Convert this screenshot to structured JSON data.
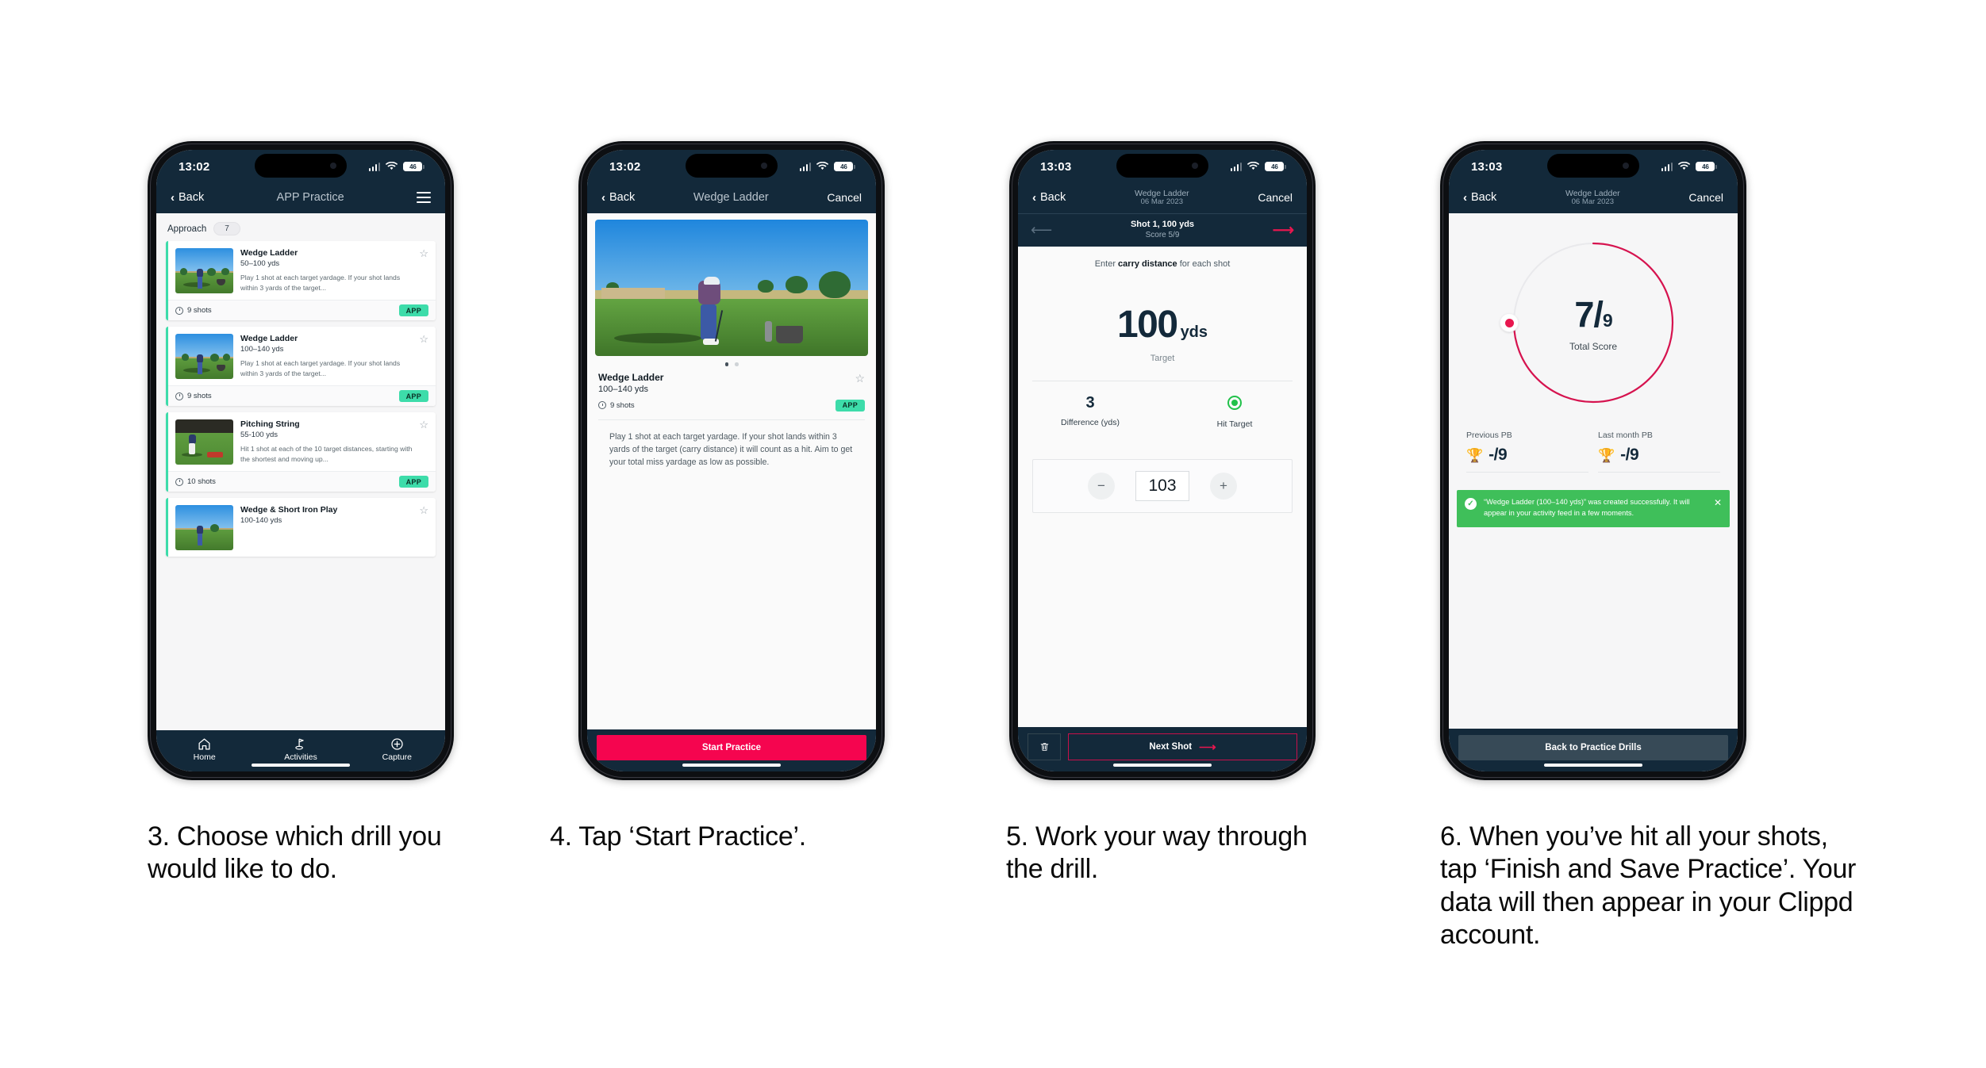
{
  "captions": [
    "3. Choose which drill you would like to do.",
    "4. Tap ‘Start Practice’.",
    "5. Work your way through the drill.",
    "6. When you’ve hit all your shots, tap ‘Finish and Save Practice’. Your data will then appear in your Clippd account."
  ],
  "colors": {
    "navy": "#13293a",
    "pink": "#f5054f",
    "mint": "#3ddcaa",
    "green": "#3fbf5a",
    "crimson": "#e8174f"
  },
  "phone1": {
    "status": {
      "time": "13:02",
      "battery": "46"
    },
    "nav": {
      "back": "Back",
      "title": "APP Practice",
      "menu_icon": "hamburger-icon"
    },
    "filter": {
      "label": "Approach",
      "count": "7"
    },
    "cards": [
      {
        "title": "Wedge Ladder",
        "yardage": "50–100 yds",
        "desc": "Play 1 shot at each target yardage. If your shot lands within 3 yards of the target...",
        "shots": "9 shots",
        "badge": "APP"
      },
      {
        "title": "Wedge Ladder",
        "yardage": "100–140 yds",
        "desc": "Play 1 shot at each target yardage. If your shot lands within 3 yards of the target...",
        "shots": "9 shots",
        "badge": "APP"
      },
      {
        "title": "Pitching String",
        "yardage": "55-100 yds",
        "desc": "Hit 1 shot at each of the 10 target distances, starting with the shortest and moving up...",
        "shots": "10 shots",
        "badge": "APP"
      },
      {
        "title": "Wedge & Short Iron Play",
        "yardage": "100-140 yds",
        "desc": "",
        "shots": "",
        "badge": ""
      }
    ],
    "tabs": [
      {
        "label": "Home",
        "icon": "home-icon"
      },
      {
        "label": "Activities",
        "icon": "golf-flag-icon"
      },
      {
        "label": "Capture",
        "icon": "plus-circle-icon"
      }
    ]
  },
  "phone2": {
    "status": {
      "time": "13:02",
      "battery": "46"
    },
    "nav": {
      "back": "Back",
      "title": "Wedge Ladder",
      "cancel": "Cancel"
    },
    "drill": {
      "title": "Wedge Ladder",
      "yardage": "100–140 yds",
      "shots": "9 shots",
      "badge": "APP",
      "description": "Play 1 shot at each target yardage. If your shot lands within 3 yards of the target (carry distance) it will count as a hit. Aim to get your total miss yardage as low as possible."
    },
    "cta": "Start Practice"
  },
  "phone3": {
    "status": {
      "time": "13:03",
      "battery": "46"
    },
    "nav": {
      "back": "Back",
      "title": "Wedge Ladder",
      "date": "06 Mar 2023",
      "cancel": "Cancel"
    },
    "shotbar": {
      "shot": "Shot 1, 100 yds",
      "score": "Score 5/9"
    },
    "hint_pre": "Enter ",
    "hint_bold": "carry distance",
    "hint_post": " for each shot",
    "target": {
      "value": "100",
      "unit": "yds",
      "caption": "Target"
    },
    "stats": [
      {
        "value": "3",
        "label": "Difference (yds)"
      },
      {
        "value": "",
        "label": "Hit Target",
        "icon": "target-hit-icon"
      }
    ],
    "stepper": {
      "minus": "−",
      "value": "103",
      "plus": "+"
    },
    "footer": {
      "delete_icon": "trash-icon",
      "next": "Next Shot"
    }
  },
  "phone4": {
    "status": {
      "time": "13:03",
      "battery": "46"
    },
    "nav": {
      "back": "Back",
      "title": "Wedge Ladder",
      "date": "06 Mar 2023",
      "cancel": "Cancel"
    },
    "gauge": {
      "score": "7",
      "separator": "/",
      "total": "9",
      "label": "Total Score",
      "percent": 78
    },
    "pbs": [
      {
        "label": "Previous PB",
        "value": "-/9",
        "icon": "trophy-icon"
      },
      {
        "label": "Last month PB",
        "value": "-/9",
        "icon": "trophy-icon"
      }
    ],
    "toast": {
      "message": "“Wedge Ladder (100–140 yds)” was created successfully. It will appear in your activity feed in a few moments.",
      "check_icon": "check-circle-icon",
      "close_icon": "close-icon"
    },
    "button": "Back to Practice Drills"
  }
}
